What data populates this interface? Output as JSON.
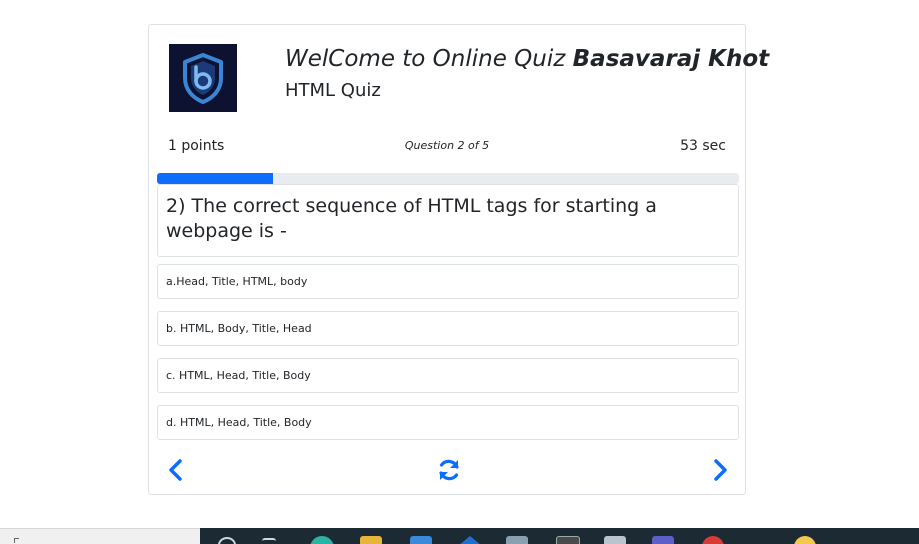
{
  "header": {
    "title_prefix": "WelCome to Online Quiz ",
    "title_name": "Basavaraj Khot",
    "subtitle": "HTML Quiz"
  },
  "quiz": {
    "points": "1 points",
    "question_counter": "Question 2 of 5",
    "timer": "53 sec",
    "progress": 0.2,
    "question": "2) The correct sequence of HTML tags for starting a webpage is -",
    "options": [
      "a.Head, Title, HTML, body",
      "b. HTML, Body, Title, Head",
      "c. HTML, Head, Title, Body",
      "d. HTML, Head, Title, Body"
    ]
  },
  "colors": {
    "accent": "#0d6efd",
    "logo_bg": "#0c1230",
    "taskbar": "#1c2b33"
  },
  "icons": {
    "logo": "shield-b-logo-icon",
    "prev": "chevron-left-icon",
    "refresh": "refresh-icon",
    "next": "chevron-right-icon"
  }
}
